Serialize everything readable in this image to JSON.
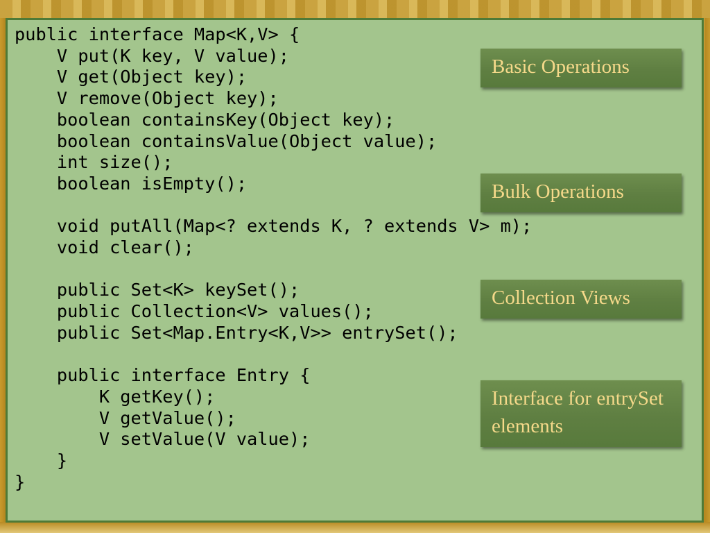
{
  "code_lines": [
    "public interface Map<K,V> {",
    "    V put(K key, V value);",
    "    V get(Object key);",
    "    V remove(Object key);",
    "    boolean containsKey(Object key);",
    "    boolean containsValue(Object value);",
    "    int size();",
    "    boolean isEmpty();",
    "",
    "    void putAll(Map<? extends K, ? extends V> m);",
    "    void clear();",
    "",
    "    public Set<K> keySet();",
    "    public Collection<V> values();",
    "    public Set<Map.Entry<K,V>> entrySet();",
    "",
    "    public interface Entry {",
    "        K getKey();",
    "        V getValue();",
    "        V setValue(V value);",
    "    }",
    "}"
  ],
  "labels": {
    "basic": "Basic Operations",
    "bulk": "Bulk Operations",
    "views": "Collection Views",
    "entry": "Interface for entrySet elements"
  },
  "colors": {
    "slide_background": "#a3c58d",
    "slide_border": "#4f7a37",
    "label_background": "#5f7f42",
    "label_text": "#f5d98a",
    "frame": "#c89a30"
  }
}
